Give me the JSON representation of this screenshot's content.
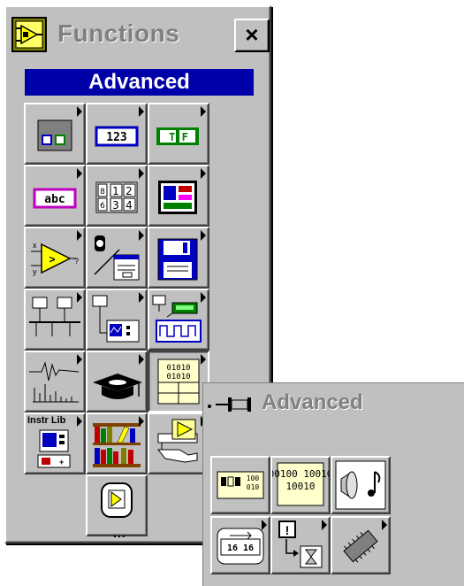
{
  "window": {
    "title": "Functions",
    "close_label": "×"
  },
  "palette": {
    "banner": "Advanced",
    "icons": [
      {
        "name": "cluster-icon"
      },
      {
        "name": "numeric-icon",
        "label": "123"
      },
      {
        "name": "boolean-icon",
        "label": "T F"
      },
      {
        "name": "string-icon",
        "label": "abc"
      },
      {
        "name": "array-icon",
        "label": "8 1 2 / 6 3 4"
      },
      {
        "name": "cluster-palette-icon"
      },
      {
        "name": "comparison-icon"
      },
      {
        "name": "time-dialog-icon"
      },
      {
        "name": "file-io-icon"
      },
      {
        "name": "communication-icon"
      },
      {
        "name": "instrument-io-icon"
      },
      {
        "name": "data-acquisition-icon"
      },
      {
        "name": "analysis-icon"
      },
      {
        "name": "tutorial-icon"
      },
      {
        "name": "advanced-icon"
      },
      {
        "name": "instrument-library-icon",
        "label": "Instr Lib"
      },
      {
        "name": "user-libraries-icon"
      },
      {
        "name": "select-vi-icon"
      },
      {
        "name": "more-functions-icon",
        "label": "..."
      }
    ]
  },
  "subpalette": {
    "title": "Advanced",
    "icons": [
      {
        "name": "data-manipulation-icon"
      },
      {
        "name": "binary-icon",
        "label": "00100 10010"
      },
      {
        "name": "sound-icon"
      },
      {
        "name": "byte-swap-icon",
        "label": "16 16"
      },
      {
        "name": "occurrences-icon"
      },
      {
        "name": "memory-chip-icon"
      }
    ]
  },
  "colors": {
    "banner_bg": "#0000a8",
    "face": "#c0c0c0",
    "numeric_blue": "#0000c0",
    "boolean_green": "#008000",
    "string_magenta": "#c000c0"
  }
}
